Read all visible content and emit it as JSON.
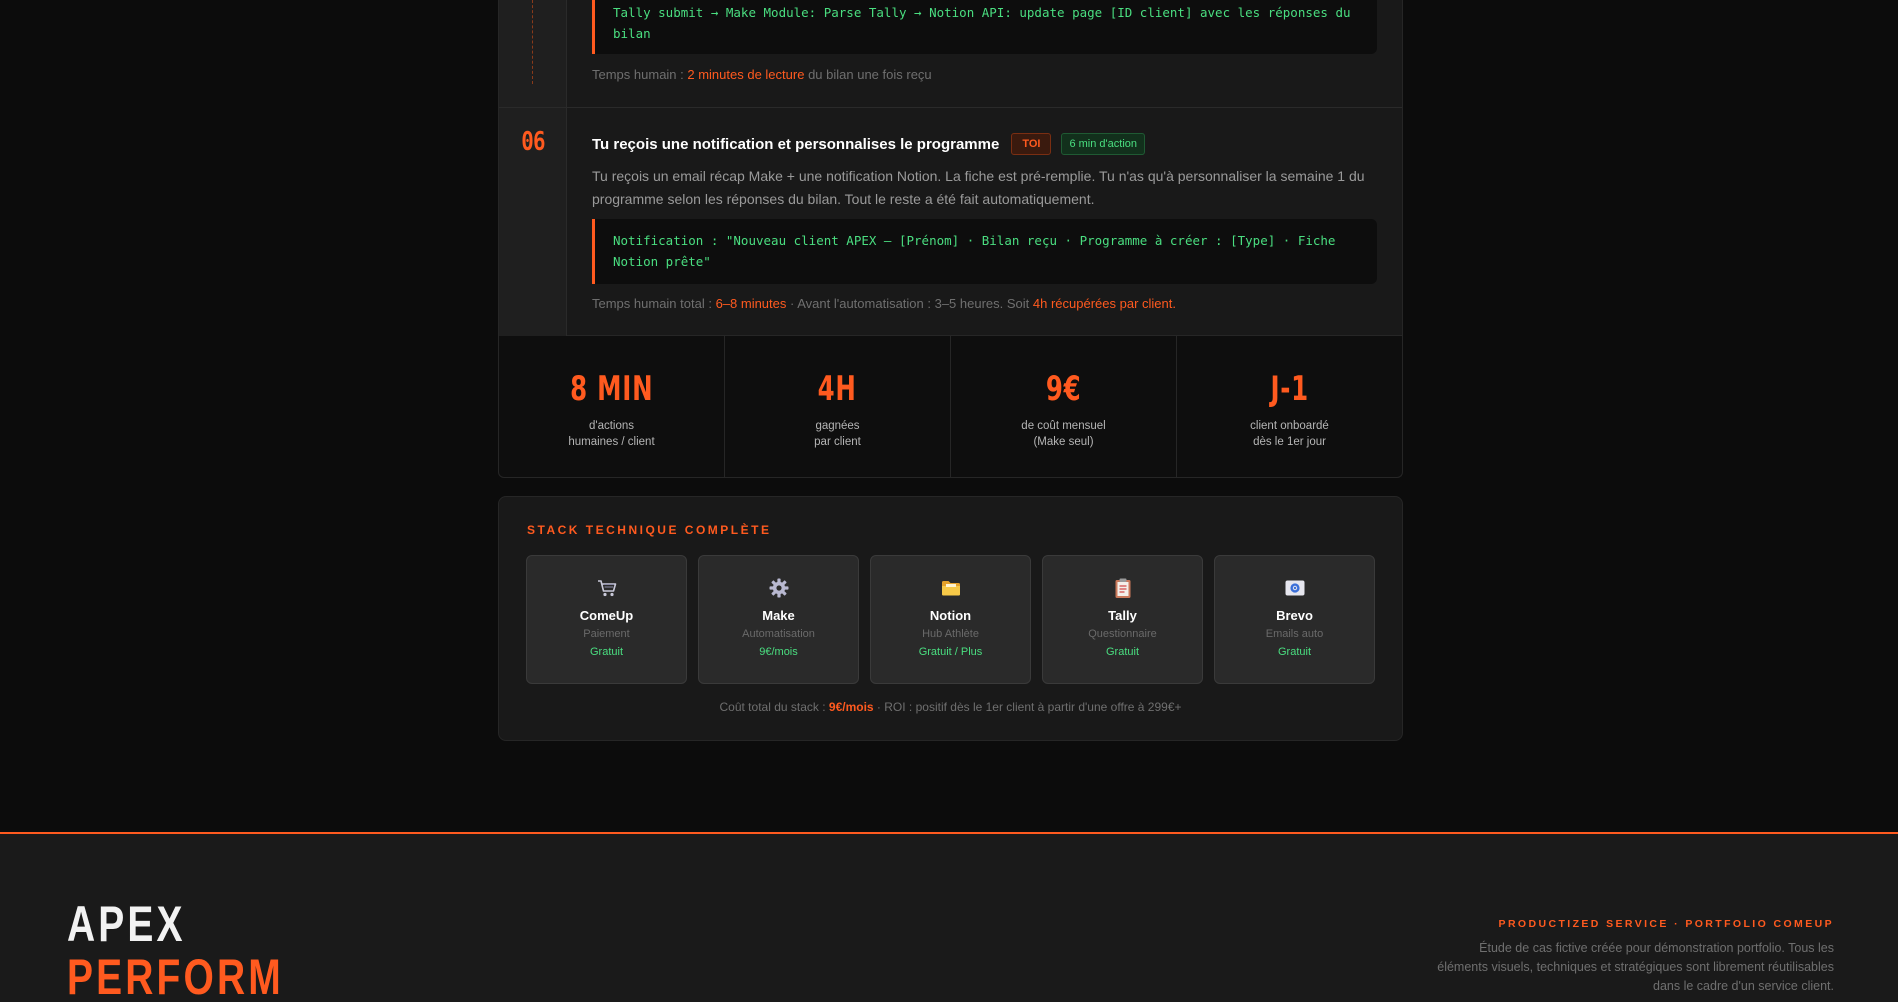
{
  "steps": {
    "previous": {
      "code": "Tally submit → Make Module: Parse Tally → Notion API: update page [ID client] avec les réponses du bilan",
      "meta_prefix": "Temps humain : ",
      "meta_highlight": "2 minutes de lecture",
      "meta_suffix": " du bilan une fois reçu"
    },
    "current": {
      "number": "06",
      "title": "Tu reçois une notification et personnalises le programme",
      "badge_role": "TOI",
      "badge_time": "6 min d'action",
      "description": "Tu reçois un email récap Make + une notification Notion. La fiche est pré-remplie. Tu n'as qu'à personnaliser la semaine 1 du programme selon les réponses du bilan. Tout le reste a été fait automatiquement.",
      "code": "Notification : \"Nouveau client APEX — [Prénom] · Bilan reçu · Programme à créer : [Type] · Fiche Notion prête\"",
      "meta_prefix": "Temps humain total : ",
      "meta_highlight1": "6–8 minutes",
      "meta_middle": " · Avant l'automatisation : 3–5 heures. Soit ",
      "meta_highlight2": "4h récupérées par client."
    }
  },
  "stats": [
    {
      "value": "8 MIN",
      "label_line1": "d'actions",
      "label_line2": "humaines / client"
    },
    {
      "value": "4H",
      "label_line1": "gagnées",
      "label_line2": "par client"
    },
    {
      "value": "9€",
      "label_line1": "de coût mensuel",
      "label_line2": "(Make seul)"
    },
    {
      "value": "J-1",
      "label_line1": "client onboardé",
      "label_line2": "dès le 1er jour"
    }
  ],
  "stack": {
    "title": "STACK TECHNIQUE COMPLÈTE",
    "tools": [
      {
        "icon": "cart-icon",
        "name": "ComeUp",
        "role": "Paiement",
        "price": "Gratuit"
      },
      {
        "icon": "gear-icon",
        "name": "Make",
        "role": "Automatisation",
        "price": "9€/mois"
      },
      {
        "icon": "folder-icon",
        "name": "Notion",
        "role": "Hub Athlète",
        "price": "Gratuit / Plus"
      },
      {
        "icon": "clipboard-icon",
        "name": "Tally",
        "role": "Questionnaire",
        "price": "Gratuit"
      },
      {
        "icon": "email-icon",
        "name": "Brevo",
        "role": "Emails auto",
        "price": "Gratuit"
      }
    ],
    "cost_prefix": "Coût total du stack : ",
    "cost_highlight": "9€/mois",
    "cost_suffix": " · ROI : positif dès le 1er client à partir d'une offre à 299€+"
  },
  "footer": {
    "logo_line1": "APEX",
    "logo_line2": "PERFORM",
    "tagline": "PRODUCTIZED SERVICE · PORTFOLIO COMEUP",
    "disclaimer": "Étude de cas fictive créée pour démonstration portfolio. Tous les éléments visuels, techniques et stratégiques sont librement réutilisables dans le cadre d'un service client."
  },
  "colors": {
    "accent": "#ff5a1f",
    "success": "#4ade80",
    "background": "#0c0c0c",
    "card": "#191919"
  }
}
